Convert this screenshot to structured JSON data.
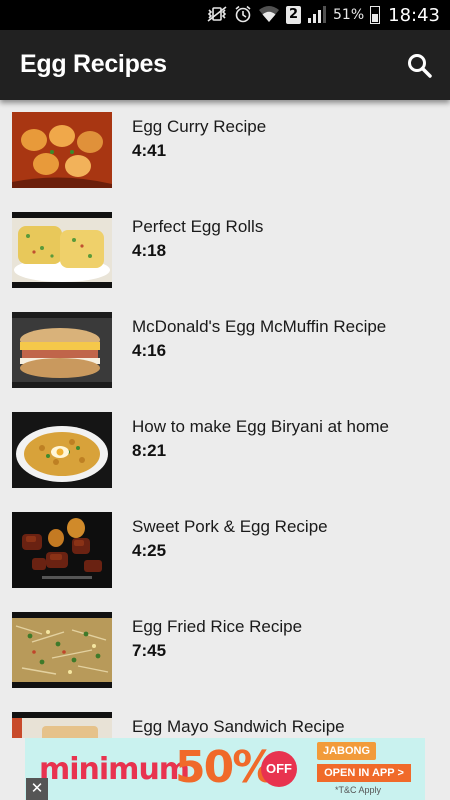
{
  "status_bar": {
    "mute_icon": "vibrate-mute-icon",
    "alarm_icon": "alarm-icon",
    "wifi_icon": "wifi-icon",
    "sim_label": "2",
    "signal_icon": "signal-icon",
    "battery_percent": "51%",
    "time": "18:43"
  },
  "app_bar": {
    "title": "Egg Recipes",
    "search_icon": "search-icon"
  },
  "videos": [
    {
      "title": "Egg Curry Recipe",
      "duration": "4:41",
      "thumb": "egg-curry"
    },
    {
      "title": "Perfect Egg Rolls",
      "duration": "4:18",
      "thumb": "egg-rolls"
    },
    {
      "title": "McDonald's Egg McMuffin Recipe",
      "duration": "4:16",
      "thumb": "mcmuffin"
    },
    {
      "title": "How to make Egg Biryani at home",
      "duration": "8:21",
      "thumb": "biryani"
    },
    {
      "title": "Sweet Pork & Egg Recipe",
      "duration": "4:25",
      "thumb": "pork-egg"
    },
    {
      "title": "Egg Fried Rice Recipe",
      "duration": "7:45",
      "thumb": "fried-rice"
    },
    {
      "title": "Egg Mayo Sandwich Recipe",
      "duration": "",
      "thumb": "mayo-sandwich"
    }
  ],
  "ad": {
    "headline": "minimum",
    "percent": "50%",
    "off": "OFF",
    "brand": "JABONG",
    "cta": "OPEN IN APP >",
    "terms": "*T&C Apply",
    "close_label": "✕"
  },
  "colors": {
    "app_bar": "#212121",
    "background": "#ececec",
    "ad_background": "#c9f2ef",
    "ad_red": "#e8334f",
    "ad_orange": "#f06a2a"
  }
}
